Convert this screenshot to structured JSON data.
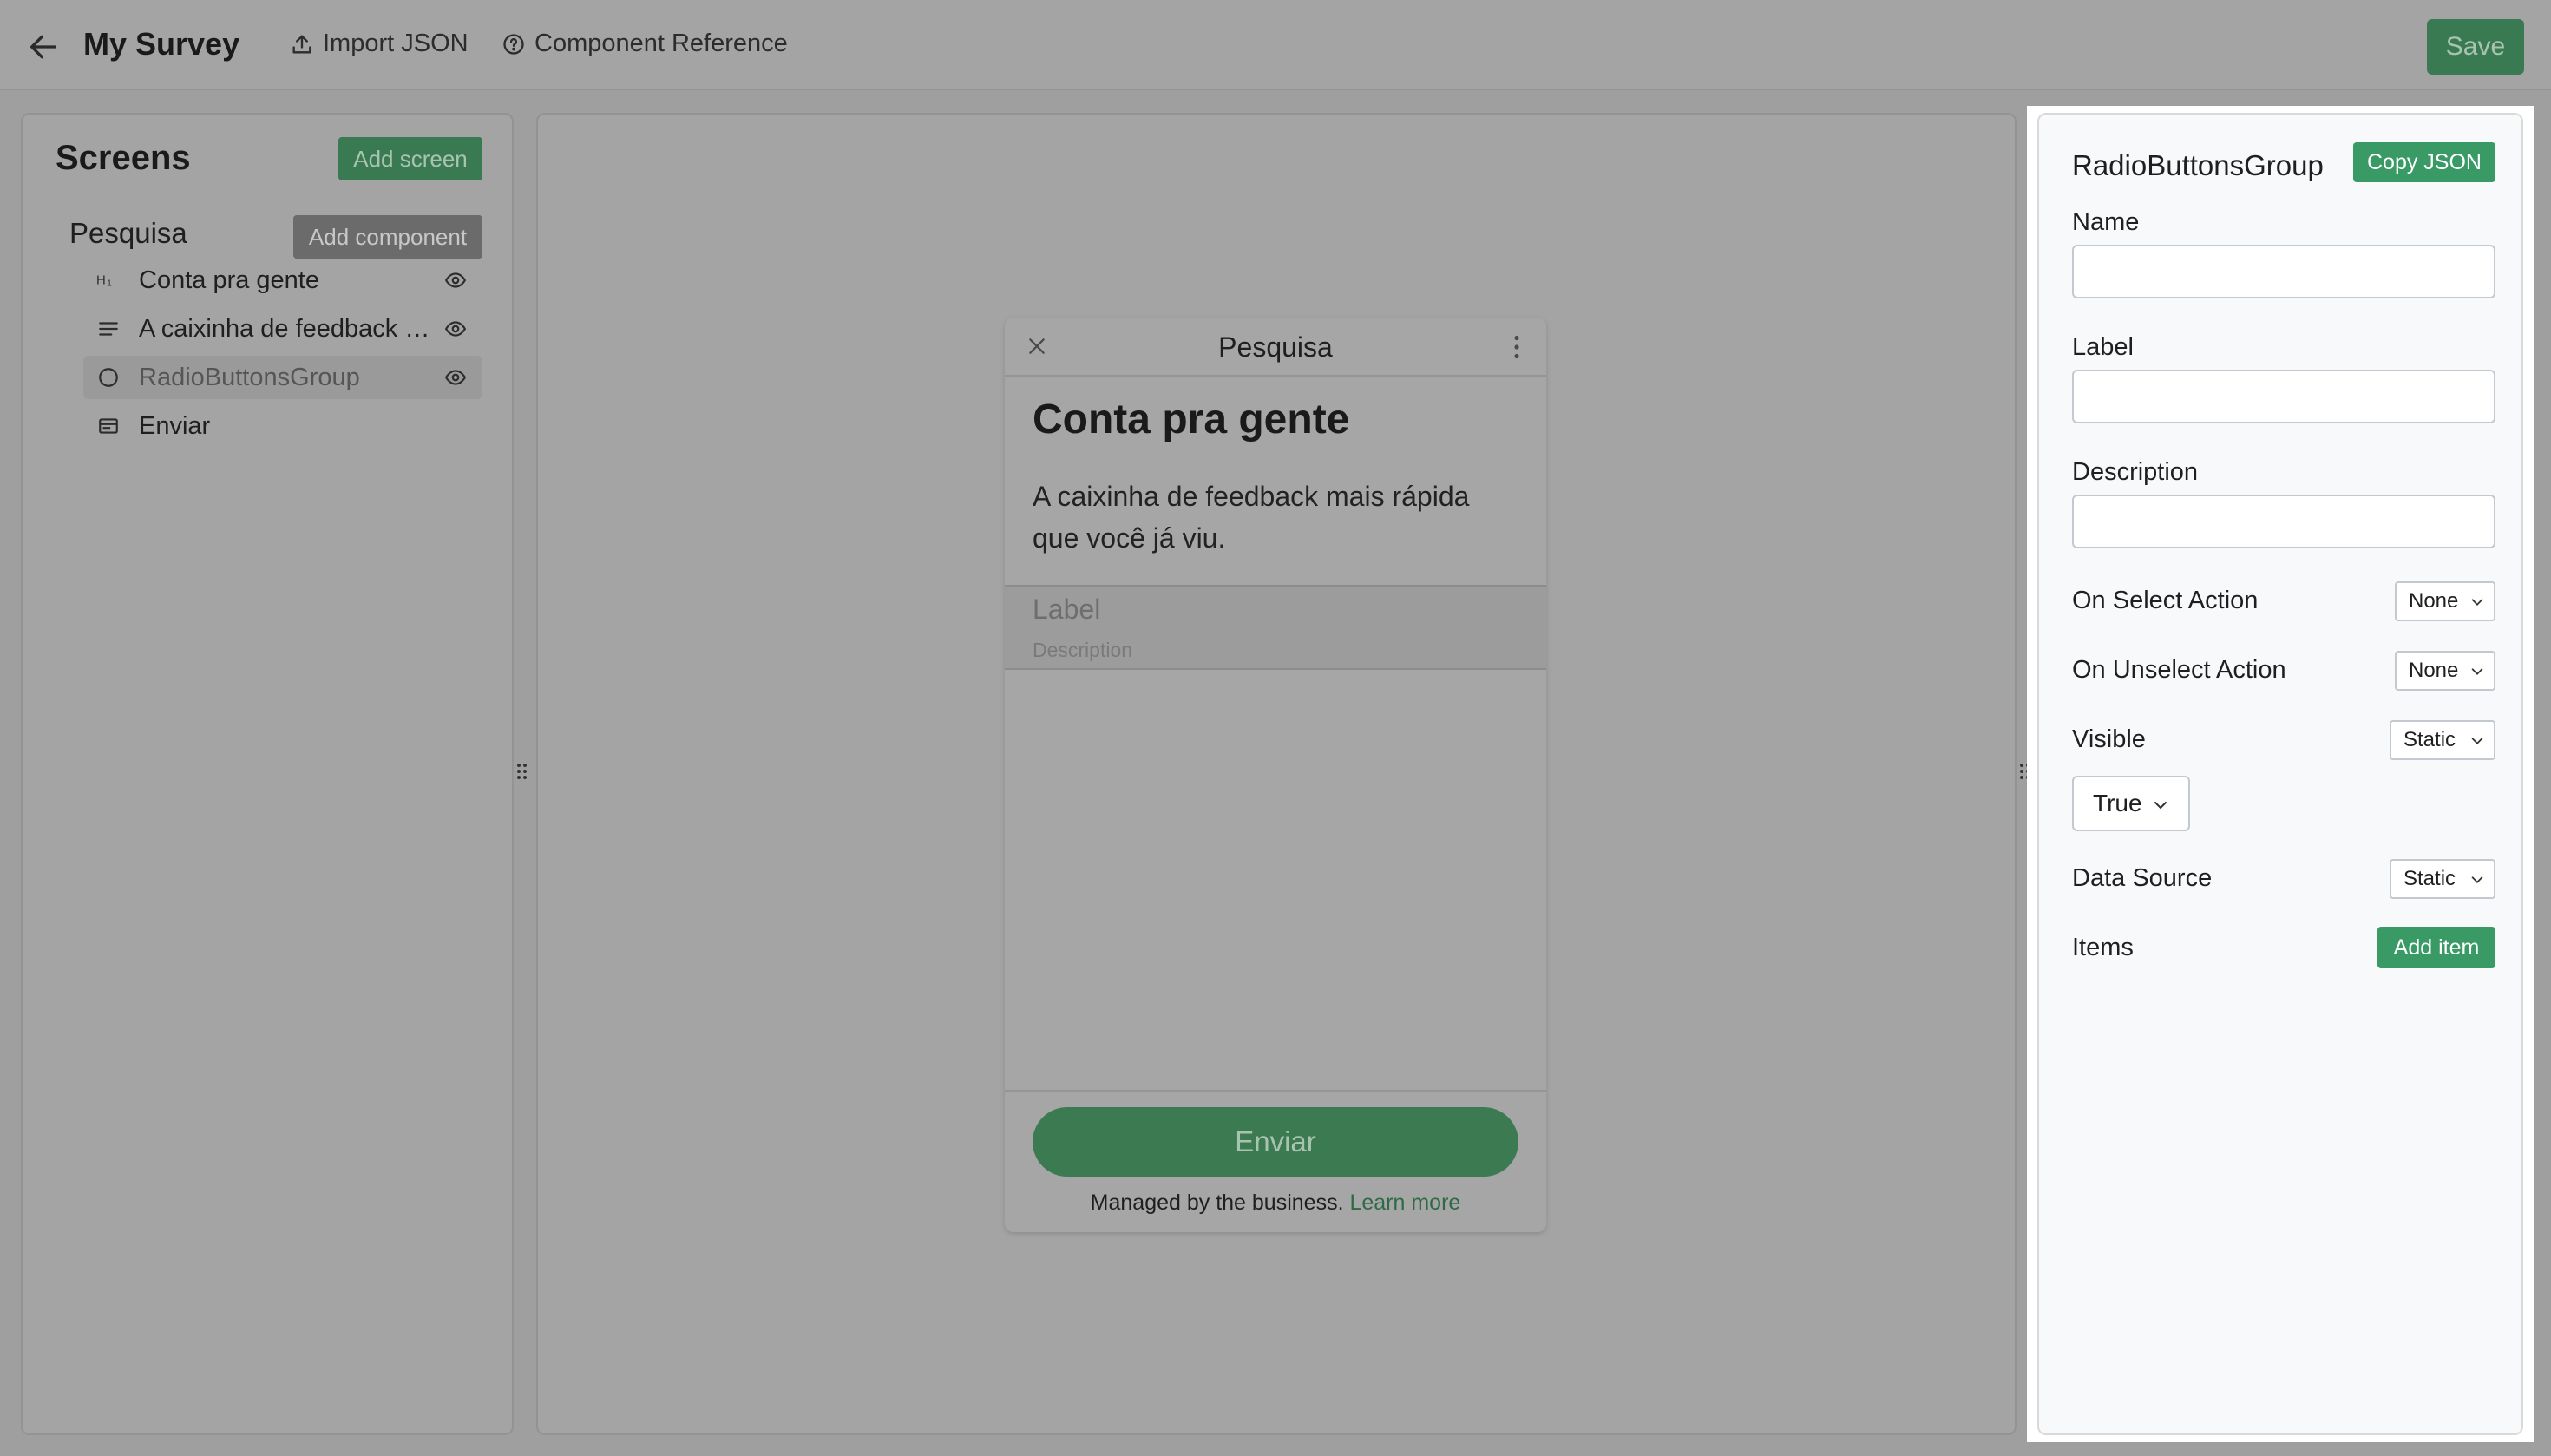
{
  "topbar": {
    "title": "My Survey",
    "import_label": "Import JSON",
    "reference_label": "Component Reference",
    "save_label": "Save"
  },
  "screens_panel": {
    "title": "Screens",
    "add_screen_label": "Add screen",
    "screen_name": "Pesquisa",
    "add_component_label": "Add component",
    "components": [
      {
        "label": "Conta pra gente",
        "icon": "heading-icon",
        "selected": false,
        "has_eye": true
      },
      {
        "label": "A caixinha de feedback mais rápida que você já viu.",
        "icon": "text-lines-icon",
        "selected": false,
        "has_eye": true
      },
      {
        "label": "RadioButtonsGroup",
        "icon": "radio-icon",
        "selected": true,
        "has_eye": true
      },
      {
        "label": "Enviar",
        "icon": "footer-icon",
        "selected": false,
        "has_eye": false
      }
    ]
  },
  "preview": {
    "screen_title": "Pesquisa",
    "heading": "Conta pra gente",
    "body": "A caixinha de feedback mais rápida que você já viu.",
    "radio_label": "Label",
    "radio_description": "Description",
    "button_label": "Enviar",
    "managed_text": "Managed by the business.",
    "learn_more": "Learn more"
  },
  "properties": {
    "component_type": "RadioButtonsGroup",
    "copy_json_label": "Copy JSON",
    "name_label": "Name",
    "name_value": "",
    "label_label": "Label",
    "label_value": "",
    "description_label": "Description",
    "description_value": "",
    "on_select_label": "On Select Action",
    "on_select_value": "None",
    "on_unselect_label": "On Unselect Action",
    "on_unselect_value": "None",
    "visible_label": "Visible",
    "visible_mode": "Static",
    "visible_value": "True",
    "data_source_label": "Data Source",
    "data_source_mode": "Static",
    "items_label": "Items",
    "add_item_label": "Add item"
  },
  "colors": {
    "accent": "#3a9a66",
    "overlay_gray": "#a4a4a4"
  }
}
